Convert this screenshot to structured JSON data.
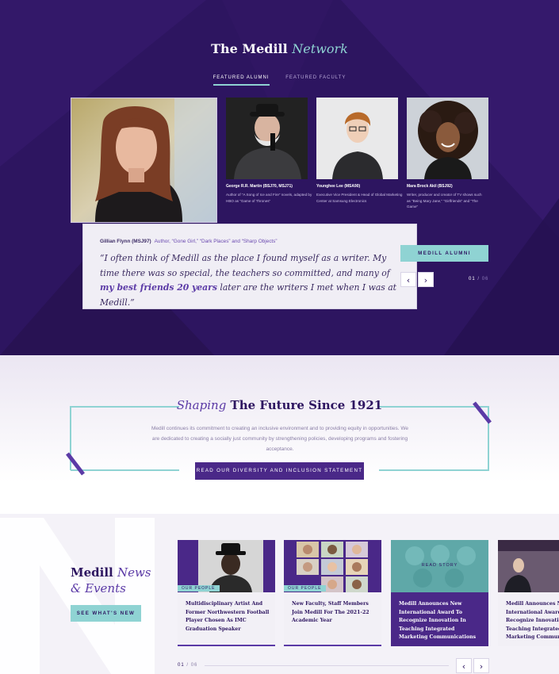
{
  "network": {
    "title_main": "The Medill",
    "title_accent": "Network",
    "tabs": [
      {
        "label": "FEATURED ALUMNI",
        "active": true
      },
      {
        "label": "FEATURED FACULTY",
        "active": false
      }
    ],
    "alumni": [
      {
        "name": "George R.R. Martin (BSJ70, MSJ71)",
        "desc": "Author of “A Song of Ice and Fire” novels, adapted by HBO as “Game of Thrones”"
      },
      {
        "name": "Younghee Lee (MSA90)",
        "desc": "Executive Vice President & Head of Global Marketing Center at Samsung Electronics"
      },
      {
        "name": "Mara Brock Akil (BSJ92)",
        "desc": "Writer, producer and creator of TV shows such as “Being Mary Jane,” “Girlfriends” and “The Game”"
      }
    ],
    "featured": {
      "name": "Gillian Flynn (MSJ97)",
      "role": "Author, “Gone Girl,” “Dark Places” and “Sharp Objects”",
      "quote_part1": "“I often think of Medill as the place I found myself as a writer. My time there was so special, the teachers so committed, and many of ",
      "quote_highlight": "my best friends 20 years",
      "quote_part2": " later are the writers I met when I was at Medill.”"
    },
    "cta": "MEDILL ALUMNI",
    "counter_current": "01",
    "counter_sep": "/",
    "counter_total": "06",
    "prev_icon": "‹",
    "next_icon": "›"
  },
  "future": {
    "title_accent": "Shaping",
    "title_main": "The Future Since 1921",
    "body": "Medill continues its commitment to creating an inclusive environment and to providing equity in opportunities. We are dedicated to creating a socially just community by strengthening policies, developing programs and fostering acceptance.",
    "button": "READ OUR DIVERSITY AND INCLUSION STATEMENT"
  },
  "news": {
    "title_main": "Medill",
    "title_accent1": "News",
    "title_accent2": "& Events",
    "button": "SEE WHAT'S NEW",
    "cards": [
      {
        "tag": "OUR PEOPLE",
        "headline": "Multidisciplinary Artist And Former Northwestern Football Player Chosen As IMC Graduation Speaker"
      },
      {
        "tag": "OUR PEOPLE",
        "headline": "New Faculty, Staff Members Join Medill For The 2021-22 Academic Year"
      },
      {
        "tag": "READ STORY",
        "headline": "Medill Announces New International Award To Recognize Innovation In Teaching Integrated Marketing Communications"
      },
      {
        "tag": "",
        "headline": "Medill Announces New International Award To Recognize Innovation In Teaching Integrated Marketing Communications"
      }
    ],
    "counter_current": "01",
    "counter_sep": "/",
    "counter_total": "06",
    "prev_icon": "‹",
    "next_icon": "›"
  },
  "colors": {
    "purple_dark": "#2d1560",
    "purple": "#4a2888",
    "teal": "#8fd3d3"
  }
}
